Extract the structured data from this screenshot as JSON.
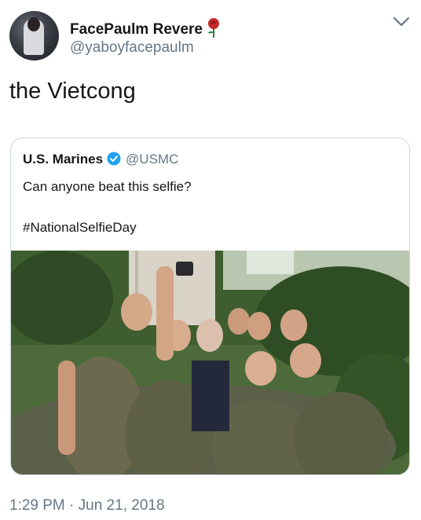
{
  "author": {
    "display_name": "FacePaulm Revere",
    "handle": "@yaboyfacepaulm",
    "emoji_icon": "rose-icon"
  },
  "tweet": {
    "text": "the Vietcong",
    "timestamp": "1:29 PM · Jun 21, 2018"
  },
  "quoted_tweet": {
    "display_name": "U.S. Marines",
    "handle": "@USMC",
    "verified": true,
    "text_line1": "Can anyone beat this selfie?",
    "text_line2": "#NationalSelfieDay",
    "photo_icon": "group-selfie-photo"
  },
  "colors": {
    "primary_text": "#14171a",
    "secondary_text": "#657786",
    "verified_blue": "#1da1f2",
    "card_border": "#ccd6dd"
  }
}
